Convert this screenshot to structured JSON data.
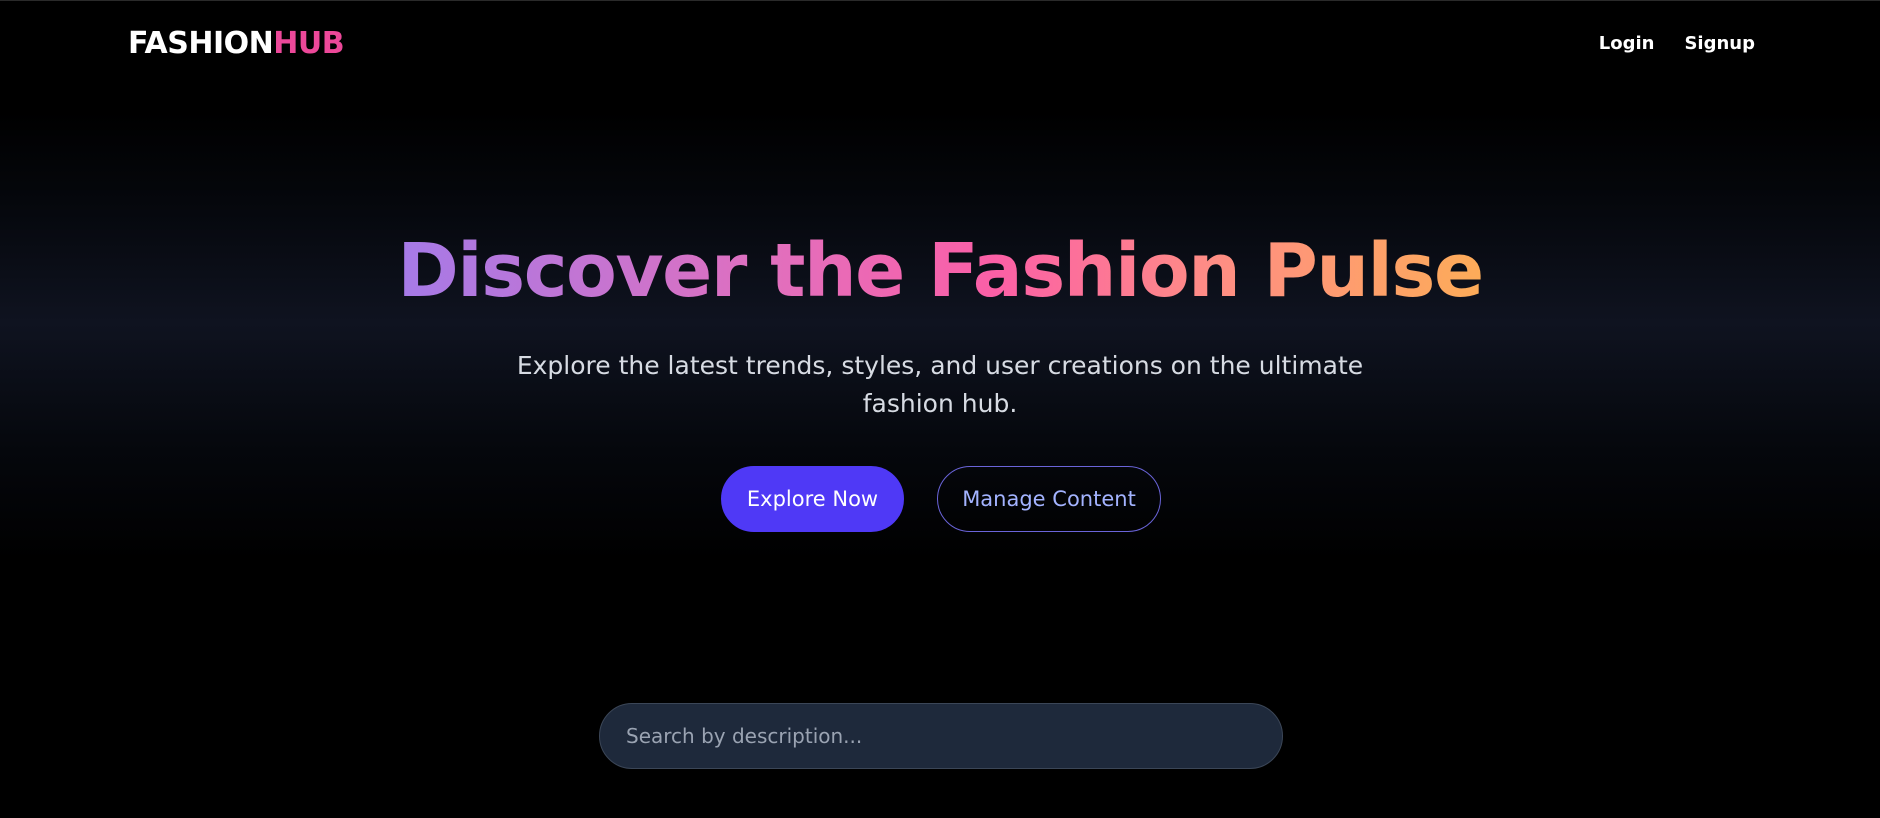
{
  "header": {
    "logo_part1": "FASHION",
    "logo_part2": "HUB",
    "nav": {
      "login_label": "Login",
      "signup_label": "Signup"
    }
  },
  "hero": {
    "title": "Discover the Fashion Pulse",
    "subtitle": "Explore the latest trends, styles, and user creations on the ultimate fashion hub.",
    "primary_button_label": "Explore Now",
    "secondary_button_label": "Manage Content"
  },
  "search": {
    "placeholder": "Search by description...",
    "value": ""
  },
  "colors": {
    "background": "#000000",
    "accent_pink": "#ec4899",
    "primary_button": "#4f39f6",
    "secondary_button_text": "#a3b3ff",
    "search_background": "#1e293b",
    "title_gradient": [
      "#a57ae8",
      "#fb5fa6",
      "#fdac58"
    ]
  }
}
